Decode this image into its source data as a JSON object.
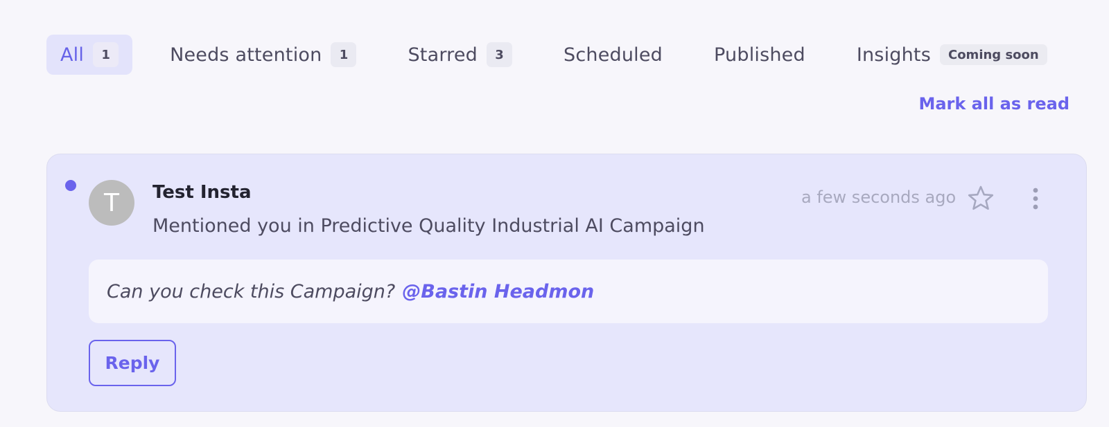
{
  "tabs": [
    {
      "label": "All",
      "count": "1"
    },
    {
      "label": "Needs attention",
      "count": "1"
    },
    {
      "label": "Starred",
      "count": "3"
    },
    {
      "label": "Scheduled"
    },
    {
      "label": "Published"
    },
    {
      "label": "Insights",
      "tag": "Coming soon"
    }
  ],
  "actions": {
    "mark_all_read": "Mark all as read"
  },
  "notification": {
    "avatar_initial": "T",
    "sender": "Test Insta",
    "message": "Mentioned you in Predictive Quality Industrial AI Campaign",
    "timestamp": "a few seconds ago",
    "comment_text": "Can you check this Campaign?",
    "mention": "@Bastin Headmon",
    "reply_label": "Reply",
    "unread": true,
    "icons": {
      "star": "star-outline-icon",
      "more": "more-vertical-icon"
    }
  },
  "colors": {
    "accent": "#6a63ec",
    "card_bg": "#e6e6fc",
    "page_bg": "#f7f6fb",
    "avatar_bg": "#bcbcbc"
  }
}
